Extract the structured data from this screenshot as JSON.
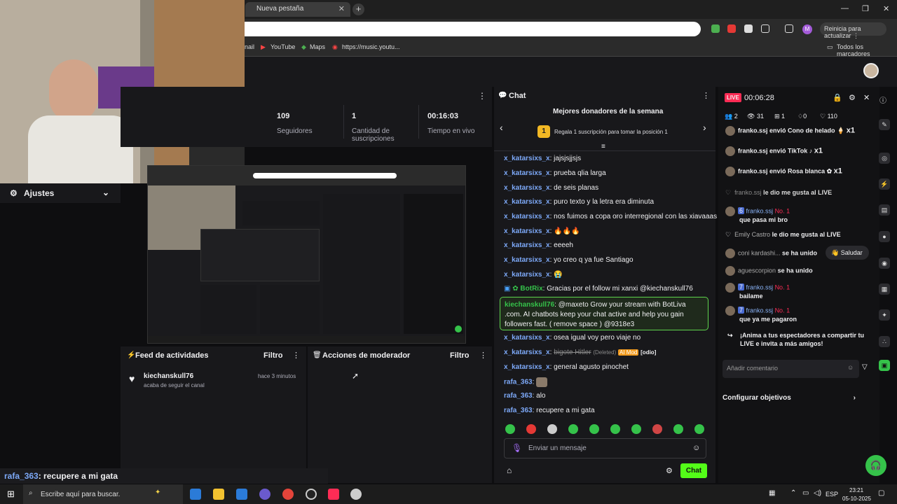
{
  "browser": {
    "tab_title": "Nueva pestaña",
    "update_label": "Reinicia para actualizar",
    "bookmarks": [
      "nail",
      "YouTube",
      "Maps",
      "https://music.youtu..."
    ],
    "all_bookmarks": "Todos los marcadores"
  },
  "stats": [
    {
      "value": "109",
      "label": "Seguidores"
    },
    {
      "value": "1",
      "label": "Cantidad de suscripciones"
    },
    {
      "value": "00:16:03",
      "label": "Tiempo en vivo"
    }
  ],
  "settings_label": "Ajustes",
  "feed": {
    "title": "Feed de actividades",
    "filter": "Filtro",
    "user": "kiechanskull76",
    "action": "acaba de seguir el canal",
    "time": "hace 3 minutos"
  },
  "mod": {
    "title": "Acciones de moderador",
    "filter": "Filtro"
  },
  "overlay_chat": {
    "user": "rafa_363",
    "text": ": recupere a mi gata"
  },
  "chat": {
    "title": "Chat",
    "donors_title": "Mejores donadores de la semana",
    "donors_rank": "1",
    "donors_text": "Regala 1 suscripción para tomar la posición 1",
    "messages": [
      {
        "user": "x_katarsixs_x",
        "text": ": jajsjsjjsjs"
      },
      {
        "user": "x_katarsixs_x",
        "text": ": prueba qlia larga"
      },
      {
        "user": "x_katarsixs_x",
        "text": ": de seis planas"
      },
      {
        "user": "x_katarsixs_x",
        "text": ": puro texto y la letra era diminuta"
      },
      {
        "user": "x_katarsixs_x",
        "text": ": nos fuimos a copa oro interregional con las xiavaaas"
      },
      {
        "user": "x_katarsixs_x",
        "text": ": 🔥🔥🔥"
      },
      {
        "user": "x_katarsixs_x",
        "text": ": eeeeh"
      },
      {
        "user": "x_katarsixs_x",
        "text": ": yo creo q ya fue Santiago"
      },
      {
        "user": "x_katarsixs_x",
        "text": ": 😭"
      },
      {
        "user": "BotRix",
        "text": ": Gracias por el follow mi xanxi @kiechanskull76"
      }
    ],
    "highlight_user": "kiechanskull76",
    "highlight_text": ": @maxeto Grow your stream with BotLiva .com. AI chatbots keep your chat active and help you gain followers fast. ( remove space ) @9318e3",
    "messages2": [
      {
        "user": "x_katarsixs_x",
        "text": ": osea igual voy pero viaje no"
      },
      {
        "user": "x_katarsixs_x",
        "text": ": "
      },
      {
        "user": "x_katarsixs_x",
        "text": ": general agusto pinochet"
      },
      {
        "user": "rafa_363",
        "text": ": "
      },
      {
        "user": "rafa_363",
        "text": ": alo"
      },
      {
        "user": "rafa_363",
        "text": ": recupere a mi gata"
      }
    ],
    "deleted_text": "bigote Hitler",
    "deleted_tag": "(Deleted)",
    "ai_mod": "AI Mod",
    "odio": "[odio]",
    "input_placeholder": "Enviar un mensaje",
    "send_label": "Chat"
  },
  "live": {
    "badge": "LIVE",
    "timer": "00:06:28",
    "counts": [
      "2",
      "31",
      "1",
      "0",
      "110"
    ],
    "gifts": [
      {
        "user": "franko.ssj",
        "text": "envió Cono de helado",
        "mult": "x1"
      },
      {
        "user": "franko.ssj",
        "text": "envió TikTok",
        "mult": "x1"
      },
      {
        "user": "franko.ssj",
        "text": "envió Rosa blanca",
        "mult": "x1"
      }
    ],
    "comments": [
      {
        "user": "franko.ssj",
        "text": "le dio me gusta al LIVE"
      },
      {
        "user": "franko.ssj",
        "text": "que pasa mi bro",
        "level": "6",
        "badge": "No. 1"
      },
      {
        "user": "Emily Castro",
        "text": "le dio me gusta al LIVE"
      },
      {
        "user": "coni kardashi...",
        "text": "se ha unido"
      },
      {
        "user": "aguescorpion",
        "text": "se ha unido"
      },
      {
        "user": "franko.ssj",
        "text": "bailame",
        "level": "7",
        "badge": "No. 1"
      },
      {
        "user": "franko.ssj",
        "text": "que ya me pagaron",
        "level": "7",
        "badge": "No. 1"
      }
    ],
    "greet": "Saludar",
    "share": "¡Anima a tus espectadores a compartir tu LIVE e invita a más amigos!",
    "comment_placeholder": "Añadir comentario",
    "goals": "Configurar objetivos"
  },
  "taskbar": {
    "search": "Escribe aquí para buscar.",
    "lang": "ESP",
    "time": "23:21",
    "date": "05-10-2025"
  }
}
